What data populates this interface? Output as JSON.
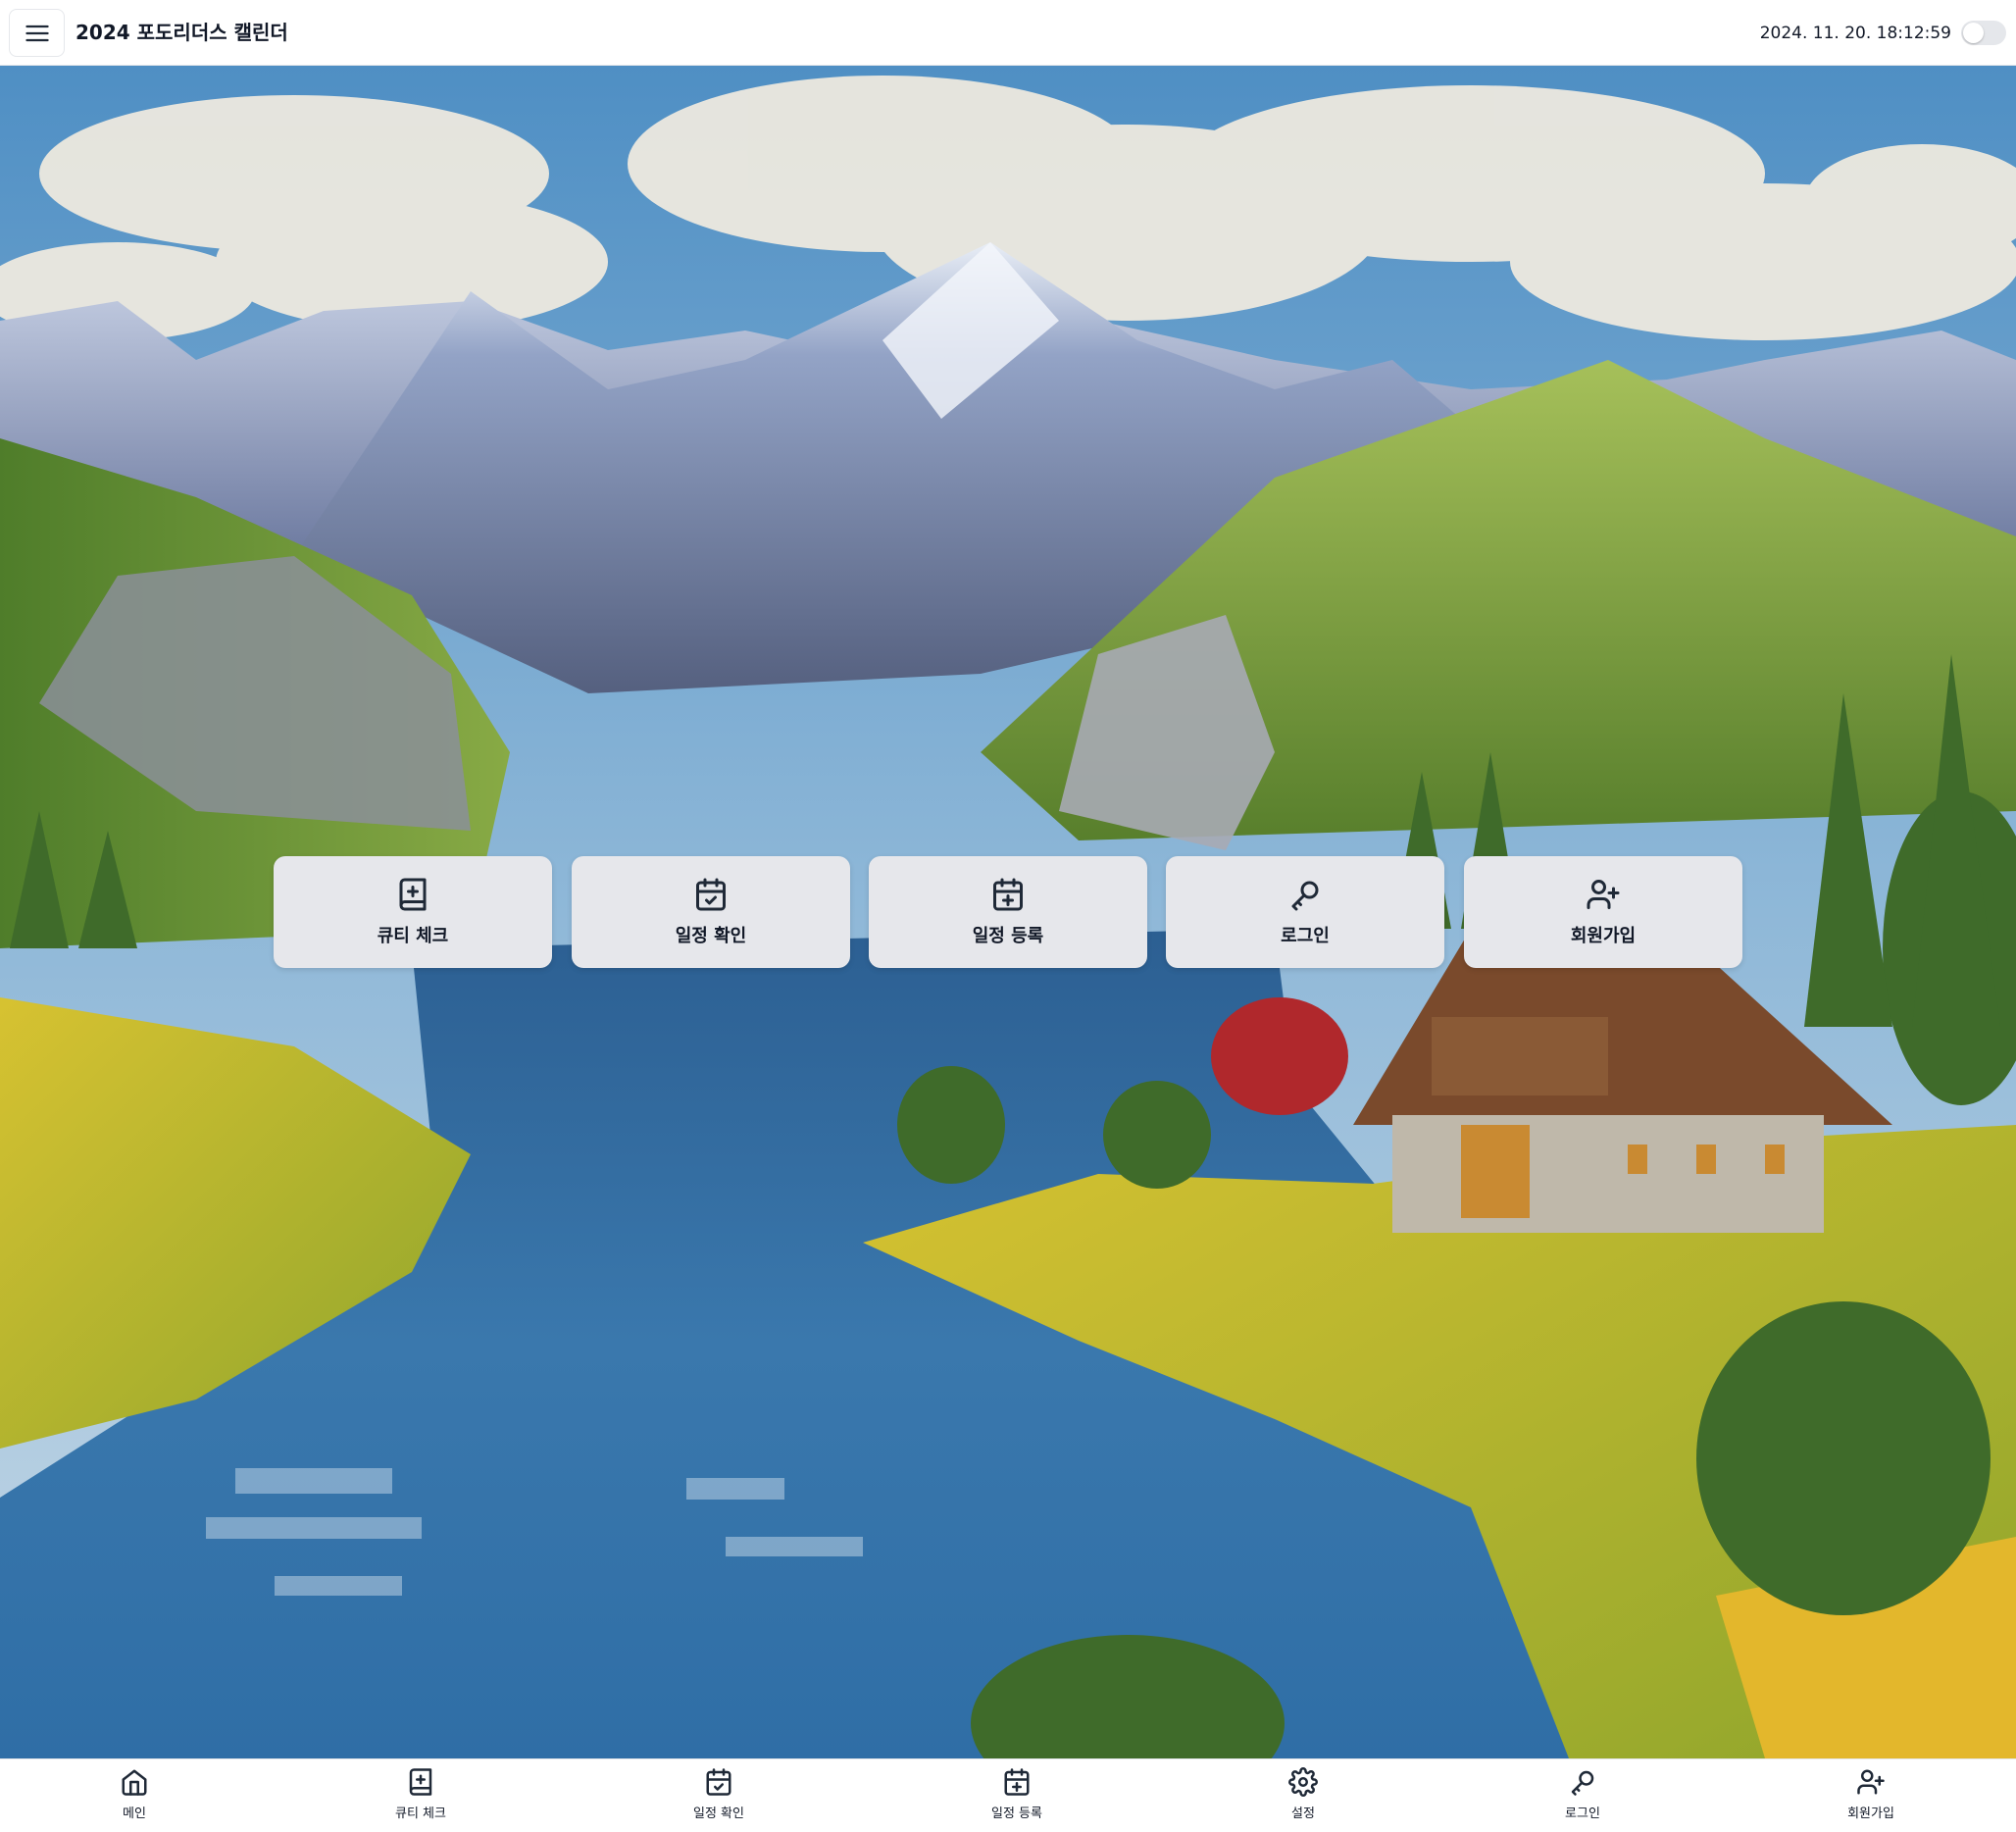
{
  "header": {
    "title": "2024 포도리더스 캘린더",
    "datetime": "2024. 11. 20. 18:12:59",
    "menu_icon": "hamburger-menu-icon",
    "dark_mode_toggle": {
      "on": false
    }
  },
  "background": {
    "description_icon": "landscape-painting"
  },
  "actions": [
    {
      "label": "큐티 체크",
      "icon": "book-plus-icon"
    },
    {
      "label": "일정 확인",
      "icon": "calendar-check-icon"
    },
    {
      "label": "일정 등록",
      "icon": "calendar-plus-icon"
    },
    {
      "label": "로그인",
      "icon": "key-icon"
    },
    {
      "label": "회원가입",
      "icon": "user-plus-icon"
    }
  ],
  "bottom_nav": [
    {
      "label": "메인",
      "icon": "home-icon"
    },
    {
      "label": "큐티 체크",
      "icon": "book-plus-icon"
    },
    {
      "label": "일정 확인",
      "icon": "calendar-check-icon"
    },
    {
      "label": "일정 등록",
      "icon": "calendar-plus-icon"
    },
    {
      "label": "설정",
      "icon": "gear-icon"
    },
    {
      "label": "로그인",
      "icon": "key-icon"
    },
    {
      "label": "회원가입",
      "icon": "user-plus-icon"
    }
  ],
  "colors": {
    "tile_background": "#e6e7eb",
    "bar_background": "#ffffff",
    "text": "#111827",
    "toggle_off": "#e5e7eb"
  }
}
